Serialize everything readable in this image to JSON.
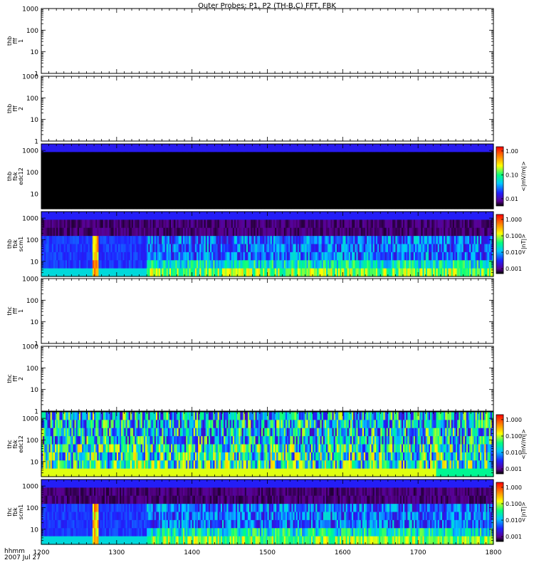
{
  "figure": {
    "title": "Outer Probes: P1, P2 (TH-B,C) FFT, FBK",
    "time_label": "hhmm",
    "date_label": "2007 Jul 27"
  },
  "chart_data": {
    "type": "heatmap",
    "x": {
      "ticks": [
        1200,
        1300,
        1400,
        1500,
        1600,
        1700,
        1800
      ],
      "tick_labels": [
        "1200",
        "1300",
        "1400",
        "1500",
        "1600",
        "1700",
        "1800"
      ],
      "range": [
        1200,
        1800
      ],
      "units": "hhmm"
    },
    "panels": [
      {
        "id": "thb-fff1",
        "ylabel": [
          "thb",
          "fff",
          "1"
        ],
        "yscale": "log",
        "ylim": [
          1,
          1000
        ],
        "yticks": [
          "1",
          "10",
          "100",
          "1000"
        ],
        "empty": true
      },
      {
        "id": "thb-fff2",
        "ylabel": [
          "thb",
          "fff",
          "2"
        ],
        "yscale": "log",
        "ylim": [
          1,
          1000
        ],
        "yticks": [
          "1",
          "10",
          "100",
          "1000"
        ],
        "empty": true
      },
      {
        "id": "thb-fbk-edc12",
        "ylabel": [
          "thb",
          "fbk",
          "edc12"
        ],
        "yscale": "log",
        "ylim": [
          2,
          2000
        ],
        "yticks": [
          "10",
          "100",
          "1000"
        ],
        "empty": false,
        "pattern": "uniform-black",
        "colorbar": {
          "label": "<|mV/m|>",
          "ticks": [
            "1.00",
            "0.10",
            "0.01"
          ],
          "range": [
            0.005,
            1.5
          ]
        }
      },
      {
        "id": "thb-fbk-scm1",
        "ylabel": [
          "thb",
          "fbk",
          "scm1"
        ],
        "yscale": "log",
        "ylim": [
          2,
          2000
        ],
        "yticks": [
          "10",
          "100",
          "1000"
        ],
        "empty": false,
        "pattern": "activity-after-1340",
        "colorbar": {
          "label": "<|nT|>",
          "ticks": [
            "1.000",
            "0.100",
            "0.010",
            "0.001"
          ],
          "range": [
            0.0005,
            2
          ]
        }
      },
      {
        "id": "thc-fff1",
        "ylabel": [
          "thc",
          "fff",
          "1"
        ],
        "yscale": "log",
        "ylim": [
          1,
          1000
        ],
        "yticks": [
          "1",
          "10",
          "100",
          "1000"
        ],
        "empty": true
      },
      {
        "id": "thc-fff2",
        "ylabel": [
          "thc",
          "fff",
          "2"
        ],
        "yscale": "log",
        "ylim": [
          1,
          1000
        ],
        "yticks": [
          "1",
          "10",
          "100",
          "1000"
        ],
        "empty": true
      },
      {
        "id": "thc-fbk-edc12",
        "ylabel": [
          "thc",
          "fbk",
          "edc12"
        ],
        "yscale": "log",
        "ylim": [
          2,
          2000
        ],
        "yticks": [
          "10",
          "100",
          "1000"
        ],
        "empty": false,
        "pattern": "broadband-active",
        "colorbar": {
          "label": "<|mV/m|>",
          "ticks": [
            "1.000",
            "0.100",
            "0.010",
            "0.001"
          ],
          "range": [
            0.0005,
            2
          ]
        }
      },
      {
        "id": "thc-fbk-scm1",
        "ylabel": [
          "thc",
          "fbk",
          "scm1"
        ],
        "yscale": "log",
        "ylim": [
          2,
          2000
        ],
        "yticks": [
          "10",
          "100",
          "1000"
        ],
        "empty": false,
        "pattern": "activity-after-1340",
        "colorbar": {
          "label": "<|nT|>",
          "ticks": [
            "1.000",
            "0.100",
            "0.010",
            "0.001"
          ],
          "range": [
            0.0005,
            2
          ]
        }
      }
    ]
  }
}
